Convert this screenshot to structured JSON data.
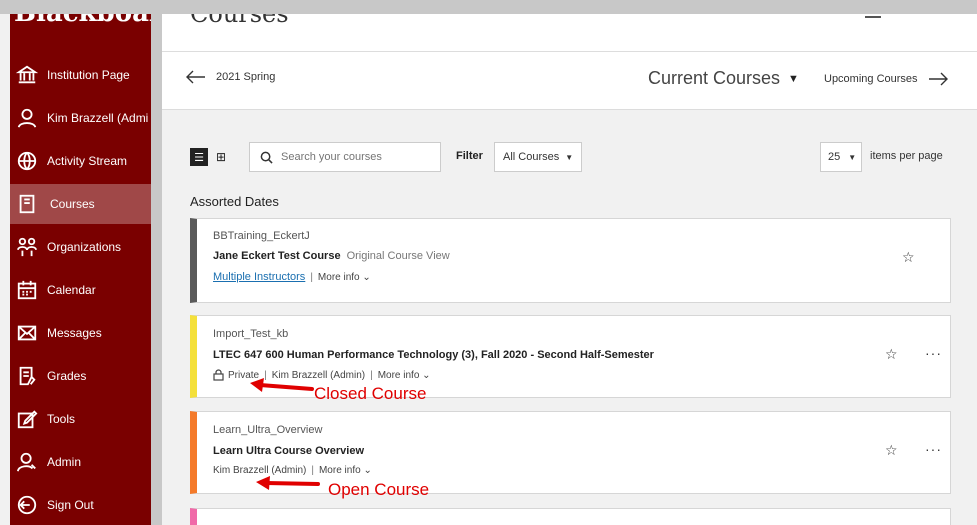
{
  "brand": "Blackboard",
  "nav": [
    {
      "label": "Institution Page",
      "icon": "institution-icon"
    },
    {
      "label": "Kim Brazzell (Admi",
      "icon": "user-icon"
    },
    {
      "label": "Activity Stream",
      "icon": "globe-icon"
    },
    {
      "label": "Courses",
      "icon": "book-icon",
      "active": true
    },
    {
      "label": "Organizations",
      "icon": "organizations-icon"
    },
    {
      "label": "Calendar",
      "icon": "calendar-icon"
    },
    {
      "label": "Messages",
      "icon": "envelope-icon"
    },
    {
      "label": "Grades",
      "icon": "grades-icon"
    },
    {
      "label": "Tools",
      "icon": "tools-icon"
    },
    {
      "label": "Admin",
      "icon": "admin-icon"
    },
    {
      "label": "Sign Out",
      "icon": "sign-out-icon"
    }
  ],
  "page_title": "Courses",
  "term": {
    "previous": "2021 Spring",
    "current": "Current Courses",
    "next": "Upcoming Courses"
  },
  "toolbar": {
    "search_placeholder": "Search your courses",
    "filter_label": "Filter",
    "filter_value": "All Courses",
    "per_page_value": "25",
    "per_page_label": "items per page"
  },
  "section_title": "Assorted Dates",
  "courses": [
    {
      "id": "BBTraining_EckertJ",
      "name": "Jane Eckert Test Course",
      "view": "Original Course View",
      "instructor": "Multiple Instructors",
      "more": "More info",
      "color": "#5a5a5a"
    },
    {
      "id": "Import_Test_kb",
      "name": "LTEC 647 600 Human Performance Technology (3), Fall 2020 - Second Half-Semester",
      "privacy": "Private",
      "instructor": "Kim Brazzell (Admin)",
      "more": "More info",
      "color": "#f4e03a"
    },
    {
      "id": "Learn_Ultra_Overview",
      "name": "Learn Ultra Course Overview",
      "instructor": "Kim Brazzell (Admin)",
      "more": "More info",
      "color": "#f47a2a"
    },
    {
      "color": "#f06aa8"
    }
  ],
  "annotations": {
    "closed": "Closed Course",
    "open": "Open Course"
  },
  "colors": {
    "sidebar": "#7a0000",
    "sidebar_active": "#a04848",
    "annotation": "#e00000"
  }
}
